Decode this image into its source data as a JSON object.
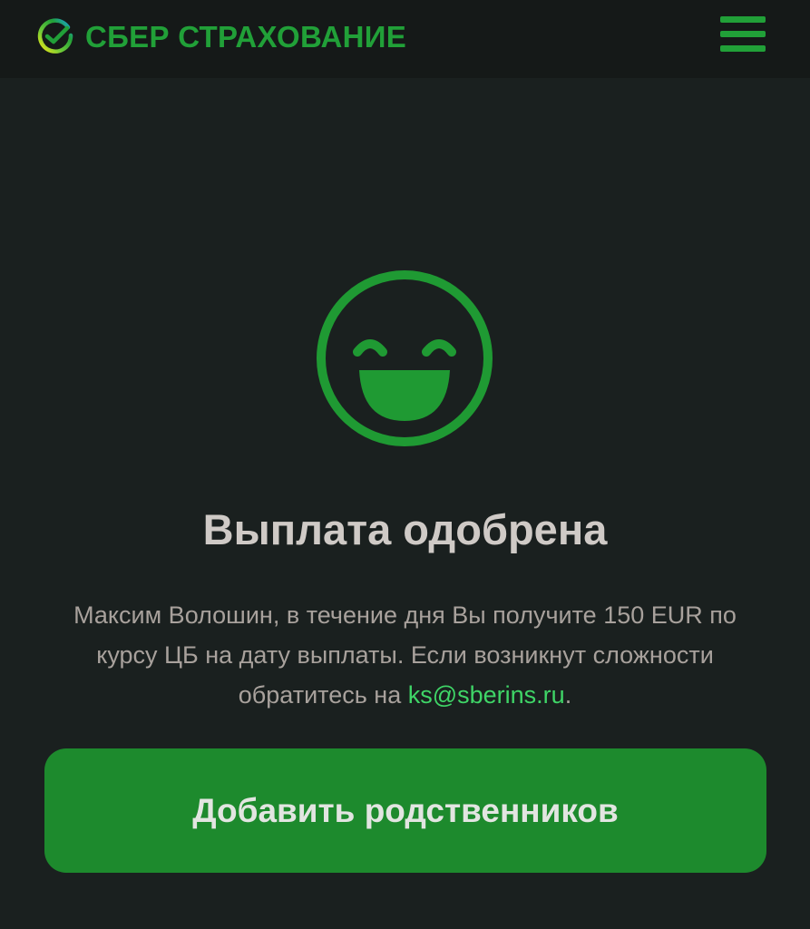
{
  "header": {
    "brand_name": "СБЕР СТРАХОВАНИЕ",
    "logo_icon": "sber-check-logo-icon",
    "menu_icon": "hamburger-menu-icon"
  },
  "status": {
    "icon": "grinning-face-icon",
    "title": "Выплата одобрена",
    "message_before_email": "Максим Волошин, в течение дня Вы получите 150 EUR по курсу ЦБ на дату выплаты. Если возникнут сложности обратитесь на ",
    "email": "ks@sberins.ru",
    "message_after_email": "."
  },
  "actions": {
    "add_relatives_label": "Добавить родственников"
  },
  "colors": {
    "background": "#1a201f",
    "header_background": "#151918",
    "brand_green": "#21a038",
    "button_green": "#1d8a2d",
    "link_green": "#3fd567"
  }
}
